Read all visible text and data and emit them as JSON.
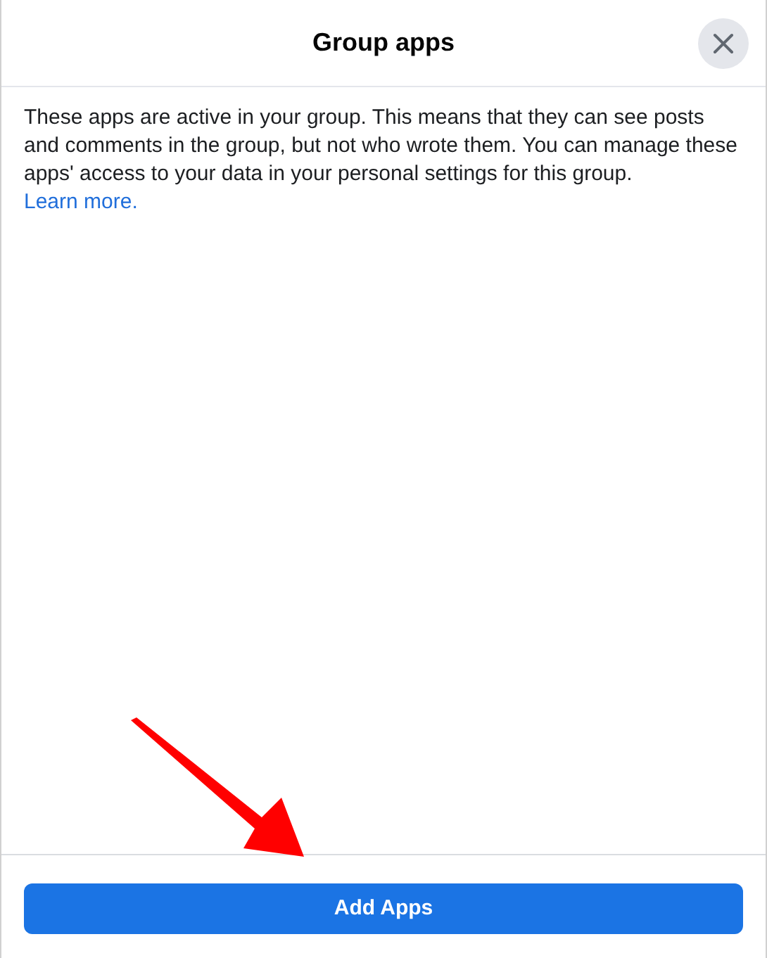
{
  "dialog": {
    "title": "Group apps",
    "description": "These apps are active in your group. This means that they can see posts and comments in the group, but not who wrote them. You can manage these apps' access to your data in your personal settings for this group.",
    "link": "Learn more."
  },
  "footer": {
    "button": "Add Apps"
  }
}
